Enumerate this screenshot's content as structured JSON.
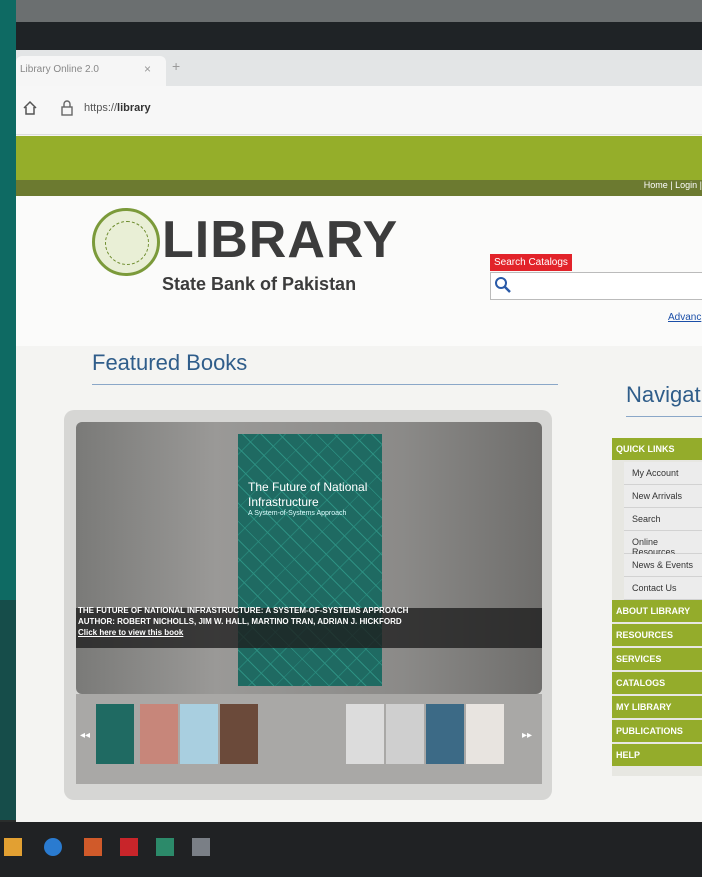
{
  "browser": {
    "tab_title": "Library Online 2.0",
    "tab_close": "×",
    "tab_new": "+",
    "url_prefix": "https://",
    "url_host": "library"
  },
  "site": {
    "top_links": [
      "Home",
      "|",
      "Login",
      "|"
    ],
    "brand": "LIBRARY",
    "subbrand": "State Bank of Pakistan",
    "search_label": "Search Catalogs",
    "advanced_link": "Advanc",
    "featured_title": "Featured Books",
    "navigation_title": "Navigatio",
    "featured_book": {
      "cover_title": "The Future of National Infrastructure",
      "cover_subtitle": "A System-of-Systems Approach",
      "caption_title": "THE FUTURE OF NATIONAL INFRASTRUCTURE: A SYSTEM-OF-SYSTEMS APPROACH",
      "caption_author": "AUTHOR: ROBERT NICHOLLS, JIM W. HALL, MARTINO TRAN, ADRIAN J. HICKFORD",
      "caption_link": "Click here to view this book"
    },
    "carousel_prev": "◂◂",
    "carousel_next": "▸▸",
    "nav": {
      "quick_links": "QUICK LINKS",
      "quick_items": [
        "My Account",
        "New Arrivals",
        "Search",
        "Online Resources",
        "News & Events",
        "Contact Us"
      ],
      "sections": [
        "ABOUT LIBRARY",
        "RESOURCES",
        "SERVICES",
        "CATALOGS",
        "MY LIBRARY",
        "PUBLICATIONS",
        "HELP"
      ]
    }
  },
  "colors": {
    "green": "#95ae2a",
    "red": "#e2232a",
    "blue_heading": "#2f5d8a",
    "teal_cover": "#1f6a62"
  }
}
